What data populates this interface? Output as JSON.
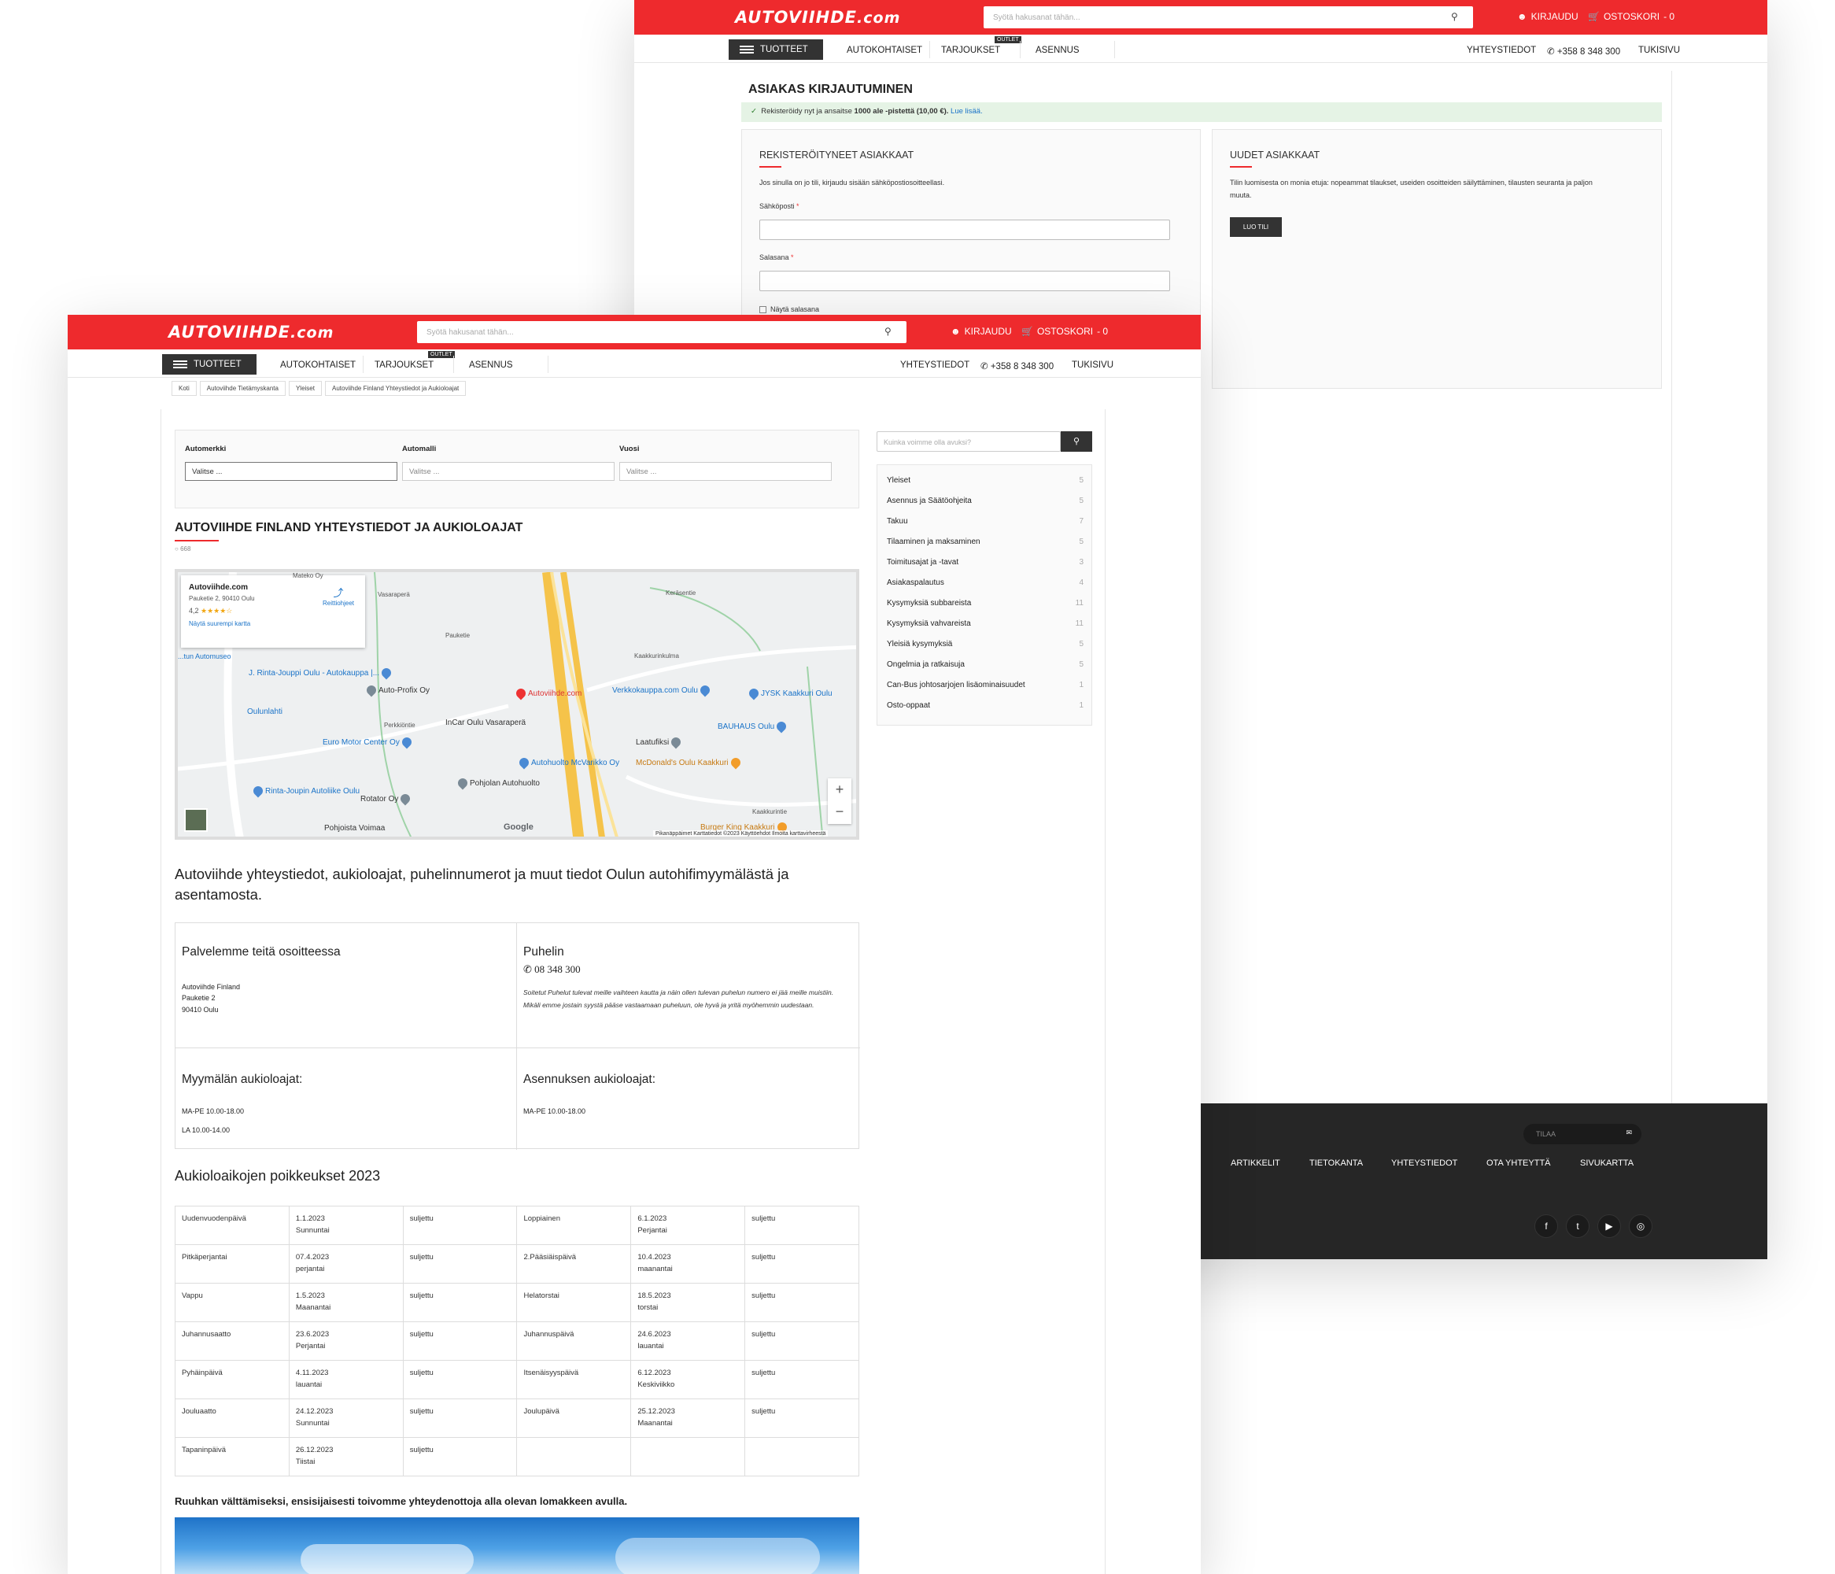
{
  "site": {
    "logo_main": "AUTOVIIHDE",
    "logo_suffix": ".com",
    "search_placeholder": "Syötä hakusanat tähän...",
    "login": "KIRJAUDU",
    "cart": "OSTOSKORI",
    "cart_count": "- 0",
    "nav": {
      "tuotteet": "TUOTTEET",
      "autokohtaiset": "AUTOKOHTAISET",
      "tarjoukset": "TARJOUKSET",
      "outlet": "OUTLET",
      "asennus": "ASENNUS",
      "yhteystiedot": "YHTEYSTIEDOT",
      "phone": "+358 8 348 300",
      "tukisivu": "TUKISIVU"
    }
  },
  "login_page": {
    "title": "ASIAKAS KIRJAUTUMINEN",
    "notice_prefix": "Rekisteröidy nyt ja ansaitse",
    "notice_bold": "1000 ale -pistettä (10,00 €).",
    "notice_link": "Lue lisää.",
    "registered": {
      "heading": "REKISTERÖITYNEET ASIAKKAAT",
      "intro": "Jos sinulla on jo tili, kirjaudu sisään sähköpostiosoitteellasi.",
      "email_label": "Sähköposti",
      "password_label": "Salasana",
      "required_mark": "*",
      "show_password": "Näytä salasana"
    },
    "new": {
      "heading": "UUDET ASIAKKAAT",
      "text_line1": "Tilin luomisesta on monia etuja: nopeammat tilaukset, useiden osoitteiden säilyttäminen, tilausten seuranta ja paljon",
      "text_line2": "muuta.",
      "button": "LUO TILI"
    },
    "footer": {
      "newsletter_placeholder": "TILAA",
      "links": [
        "ARTIKKELIT",
        "TIETOKANTA",
        "YHTEYSTIEDOT",
        "OTA YHTEYTTÄ",
        "SIVUKARTTA"
      ],
      "social": [
        "f",
        "t",
        "▶",
        "◎"
      ]
    }
  },
  "contact_page": {
    "breadcrumb": [
      "Koti",
      "Autoviihde Tietämyskanta",
      "Yleiset",
      "Autoviihde Finland Yhteystiedot ja Aukioloajat"
    ],
    "filters": {
      "automerkki": "Automerkki",
      "automalli": "Automalli",
      "vuosi": "Vuosi",
      "placeholder": "Valitse ..."
    },
    "title": "AUTOVIIHDE FINLAND YHTEYSTIEDOT JA AUKIOLOAJAT",
    "views": "668",
    "map": {
      "place_name": "Autoviihde.com",
      "address": "Pauketie 2, 90410 Oulu",
      "rating": "4,2",
      "stars": "★★★★☆",
      "directions": "Reittiohjeet",
      "larger_map": "Näytä suurempi kartta",
      "google": "Google",
      "footer": "Pikanäppäimet   Karttatiedot ©2023   Käyttöehdot   Ilmoita karttavirheestä",
      "labels": [
        "Autoviihde.com",
        "Auto-Profix Oy",
        "Verkkokauppa.com Oulu",
        "JYSK Kaakkuri Oulu",
        "BAUHAUS Oulu",
        "Euro Motor Center Oy",
        "InCar Oulu Vasaraperä",
        "Laatufiksi",
        "Autohuolto McVarikko Oy",
        "McDonald's Oulu Kaakkuri",
        "Pohjolan Autohuolto",
        "Rotator Oy",
        "Rinta-Joupin Autoliike Oulu",
        "J. Rinta-Jouppi Oulu - Autokauppa |...",
        "Oulunlahti",
        "Burger King Kaakkuri",
        "Pohjoista Voimaa",
        "Kerāsentie",
        "Kaakkurinkulma",
        "Pauketie",
        "Perkkiöntie",
        "Kaakkurintie",
        "Vasaraperä",
        "Mateko Oy",
        "...tun Automuseo"
      ]
    },
    "intro": "Autoviihde yhteystiedot, aukioloajat, puhelinnumerot ja muut tiedot Oulun autohifimyymälästä ja asentamosta.",
    "address_title": "Palvelemme teitä osoitteessa",
    "address_lines": [
      "Autoviihde Finland",
      "Pauketie 2",
      "90410 Oulu"
    ],
    "phone_title": "Puhelin",
    "phone": "08 348 300",
    "phone_note": "Soitetut Puhelut tulevat meille vaihteen kautta ja näin ollen tulevan puhelun numero ei jää meille muistiin. Mikäli emme jostain syystä pääse vastaamaan puheluun, ole hyvä ja yritä myöhemmin uudestaan.",
    "store_hours_title": "Myymälän aukioloajat:",
    "store_hours": [
      "MA-PE 10.00-18.00",
      "LA 10.00-14.00"
    ],
    "install_hours_title": "Asennuksen aukioloajat:",
    "install_hours": [
      "MA-PE 10.00-18.00"
    ],
    "exceptions_title": "Aukioloaikojen poikkeukset 2023",
    "exceptions": [
      [
        "Uudenvuodenpäivä",
        "1.1.2023",
        "Sunnuntai",
        "suljettu",
        "Loppiainen",
        "6.1.2023",
        "Perjantai",
        "suljettu"
      ],
      [
        "Pitkäperjantai",
        "07.4.2023",
        "perjantai",
        "suljettu",
        "2.Pääsiäispäivä",
        "10.4.2023",
        "maanantai",
        "suljettu"
      ],
      [
        "Vappu",
        "1.5.2023",
        "Maanantai",
        "suljettu",
        "Helatorstai",
        "18.5.2023",
        "torstai",
        "suljettu"
      ],
      [
        "Juhannusaatto",
        "23.6.2023",
        "Perjantai",
        "suljettu",
        "Juhannuspäivä",
        "24.6.2023",
        "lauantai",
        "suljettu"
      ],
      [
        "Pyhäinpäivä",
        "4.11.2023",
        "lauantai",
        "suljettu",
        "Itsenäisyyspäivä",
        "6.12.2023",
        "Keskiviikko",
        "suljettu"
      ],
      [
        "Jouluaatto",
        "24.12.2023",
        "Sunnuntai",
        "suljettu",
        "Joulupäivä",
        "25.12.2023",
        "Maanantai",
        "suljettu"
      ],
      [
        "Tapaninpäivä",
        "26.12.2023",
        "Tiistai",
        "suljettu",
        "",
        "",
        "",
        ""
      ]
    ],
    "contact_form_note": "Ruuhkan välttämiseksi, ensisijaisesti toivomme yhteydenottoja alla olevan lomakkeen avulla.",
    "sidebar": {
      "search_placeholder": "Kuinka voimme olla avuksi?",
      "categories": [
        [
          "Yleiset",
          "5"
        ],
        [
          "Asennus ja Säätöohjeita",
          "5"
        ],
        [
          "Takuu",
          "7"
        ],
        [
          "Tilaaminen ja maksaminen",
          "5"
        ],
        [
          "Toimitusajat ja -tavat",
          "3"
        ],
        [
          "Asiakaspalautus",
          "4"
        ],
        [
          "Kysymyksiä subbareista",
          "11"
        ],
        [
          "Kysymyksiä vahvareista",
          "11"
        ],
        [
          "Yleisiä kysymyksiä",
          "5"
        ],
        [
          "Ongelmia ja ratkaisuja",
          "5"
        ],
        [
          "Can-Bus johtosarjojen lisäominaisuudet",
          "1"
        ],
        [
          "Osto-oppaat",
          "1"
        ]
      ]
    }
  },
  "colors": {
    "brand_red": "#ee2a2d",
    "dark": "#333333",
    "footer_bg": "#262626",
    "notice_bg": "#e5f3e5"
  }
}
